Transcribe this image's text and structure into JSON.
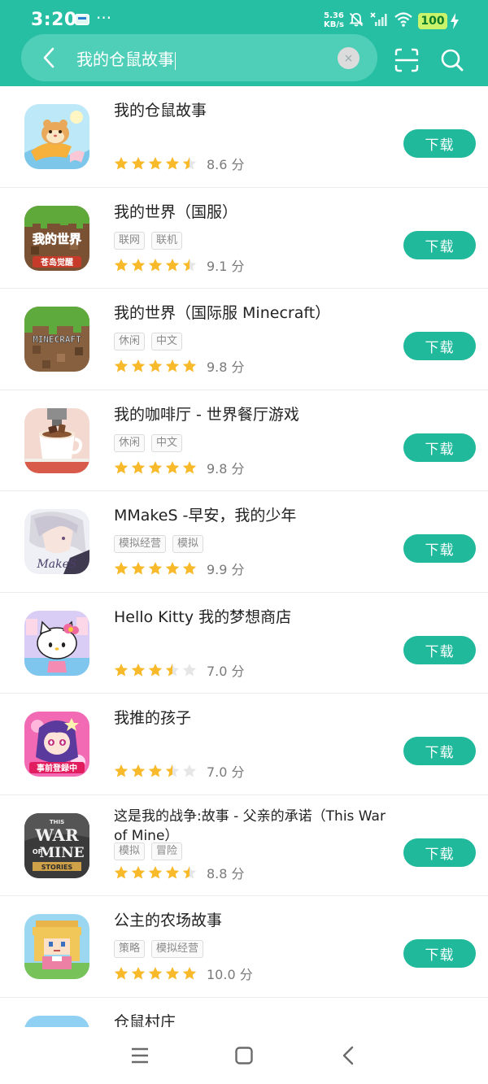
{
  "status_bar": {
    "time": "3:20",
    "more": "···",
    "net_speed_value": "5.36",
    "net_speed_unit": "KB/s",
    "battery": "100"
  },
  "search": {
    "query": "我的仓鼠故事",
    "clear_symbol": "×"
  },
  "icons": {
    "back": "back-arrow-icon",
    "clear": "clear-icon",
    "scan": "scan-icon",
    "search": "search-icon"
  },
  "colors": {
    "primary": "#26bfa4",
    "button": "#21b99c",
    "star": "#f8b92a",
    "star_empty": "#e6e6e6"
  },
  "results": [
    {
      "title": "我的仓鼠故事",
      "tags": [],
      "stars": 4.5,
      "score": "8.6 分",
      "button": "下载"
    },
    {
      "title": "我的世界（国服）",
      "tags": [
        "联网",
        "联机"
      ],
      "stars": 4.5,
      "score": "9.1 分",
      "button": "下载"
    },
    {
      "title": "我的世界（国际服 Minecraft）",
      "tags": [
        "休闲",
        "中文"
      ],
      "stars": 5,
      "score": "9.8 分",
      "button": "下载"
    },
    {
      "title": "我的咖啡厅 - 世界餐厅游戏",
      "tags": [
        "休闲",
        "中文"
      ],
      "stars": 5,
      "score": "9.8 分",
      "button": "下载"
    },
    {
      "title": "MMakeS -早安，我的少年",
      "tags": [
        "模拟经营",
        "模拟"
      ],
      "stars": 5,
      "score": "9.9 分",
      "button": "下载"
    },
    {
      "title": "Hello Kitty 我的梦想商店",
      "tags": [],
      "stars": 3.5,
      "score": "7.0 分",
      "button": "下载"
    },
    {
      "title": "我推的孩子",
      "tags": [],
      "stars": 3.5,
      "score": "7.0 分",
      "button": "下载"
    },
    {
      "title": "这是我的战争:故事 - 父亲的承诺（This War of Mine）",
      "tags": [
        "模拟",
        "冒险"
      ],
      "stars": 4.5,
      "score": "8.8 分",
      "button": "下载"
    },
    {
      "title": "公主的农场故事",
      "tags": [
        "策略",
        "模拟经营"
      ],
      "stars": 5,
      "score": "10.0 分",
      "button": "下载"
    },
    {
      "title": "仓鼠村庄",
      "tags": [],
      "stars": 0,
      "score": "",
      "button": ""
    }
  ],
  "app_icons": {
    "minecraft_cn_word": "我的世界",
    "minecraft_cn_sub": "苍岛觉醒",
    "minecraft_int_word": "MINECRAFT",
    "makes_word": "MakeS",
    "oshinoko_banner": "事前登録中",
    "war_the": "THIS",
    "war_war": "WAR",
    "war_of": "OF",
    "war_mine": "MINE",
    "war_stories": "STORIES"
  }
}
